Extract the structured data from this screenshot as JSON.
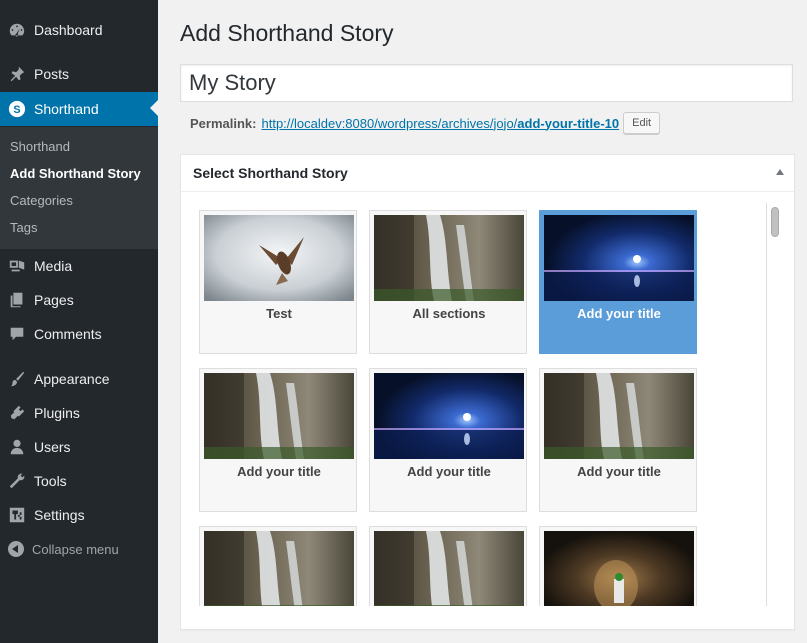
{
  "sidebar": {
    "items": [
      {
        "label": "Dashboard",
        "icon": "dashboard-icon"
      },
      {
        "label": "Posts",
        "icon": "pin-icon"
      },
      {
        "label": "Shorthand",
        "icon": "shorthand-s-icon",
        "active": true
      },
      {
        "label": "Media",
        "icon": "media-icon"
      },
      {
        "label": "Pages",
        "icon": "pages-icon"
      },
      {
        "label": "Comments",
        "icon": "comment-icon"
      },
      {
        "label": "Appearance",
        "icon": "paintbrush-icon"
      },
      {
        "label": "Plugins",
        "icon": "plugin-icon"
      },
      {
        "label": "Users",
        "icon": "user-icon"
      },
      {
        "label": "Tools",
        "icon": "wrench-icon"
      },
      {
        "label": "Settings",
        "icon": "settings-icon"
      }
    ],
    "submenu": [
      {
        "label": "Shorthand"
      },
      {
        "label": "Add Shorthand Story",
        "current": true
      },
      {
        "label": "Categories"
      },
      {
        "label": "Tags"
      }
    ],
    "collapse_label": "Collapse menu"
  },
  "page": {
    "title": "Add Shorthand Story",
    "story_title_value": "My Story",
    "permalink_label": "Permalink:",
    "permalink_base": "http://localdev:8080/wordpress/archives/jojo/",
    "permalink_slug": "add-your-title-10",
    "edit_label": "Edit"
  },
  "metabox": {
    "title": "Select Shorthand Story",
    "stories": [
      {
        "title": "Test",
        "thumb": "hawk"
      },
      {
        "title": "All sections",
        "thumb": "waterfall"
      },
      {
        "title": "Add your title",
        "thumb": "night-lake",
        "selected": true
      },
      {
        "title": "Add your title",
        "thumb": "waterfall"
      },
      {
        "title": "Add your title",
        "thumb": "night-lake"
      },
      {
        "title": "Add your title",
        "thumb": "waterfall"
      },
      {
        "title": "",
        "thumb": "waterfall"
      },
      {
        "title": "",
        "thumb": "waterfall"
      },
      {
        "title": "",
        "thumb": "cave"
      }
    ]
  },
  "colors": {
    "sidebar_bg": "#23282d",
    "submenu_bg": "#32373c",
    "active": "#0073aa",
    "selected_card": "#5b9dd9",
    "link": "#0073aa"
  }
}
